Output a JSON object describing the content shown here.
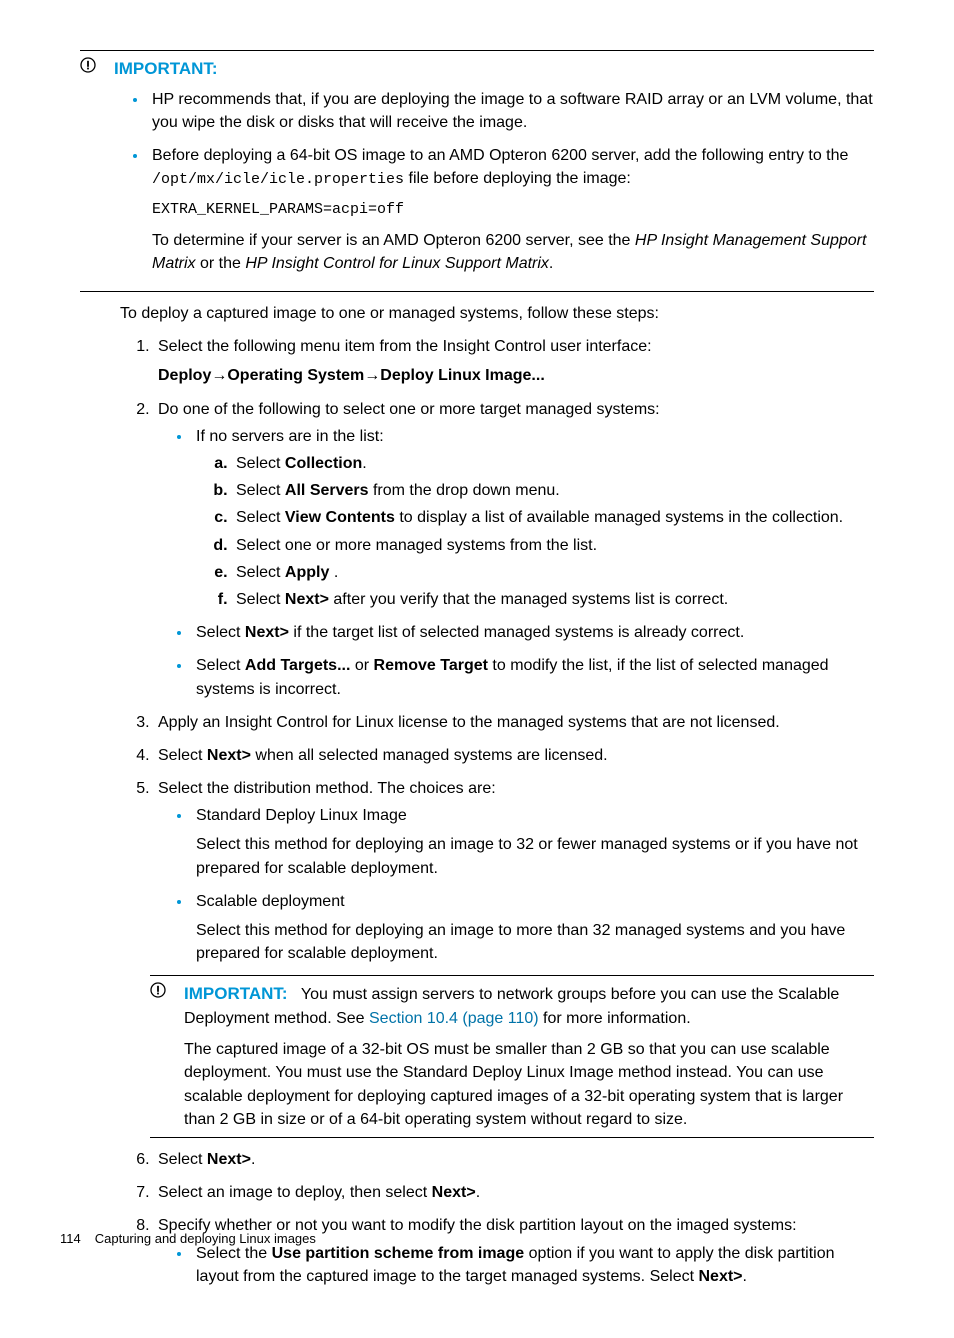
{
  "important1": {
    "label": "IMPORTANT:",
    "li1": "HP recommends that, if you are deploying the image to a software RAID array or an LVM volume, that you wipe the disk or disks that will receive the image.",
    "li2_a": "Before deploying a 64-bit OS image to an AMD Opteron 6200 server, add the following entry to the ",
    "li2_code": "/opt/mx/icle/icle.properties",
    "li2_b": " file before deploying the image:",
    "li2_block": "EXTRA_KERNEL_PARAMS=acpi=off",
    "li2_c": "To determine if your server is an AMD Opteron 6200 server, see the ",
    "li2_i1": "HP Insight Management Support Matrix",
    "li2_d": "  or the ",
    "li2_i2": "HP Insight Control for Linux Support Matrix",
    "li2_e": "."
  },
  "intro": "To deploy a captured image to one or managed systems, follow these steps:",
  "step1": {
    "text": "Select the following menu item from the Insight Control user interface:",
    "menu_a": "Deploy",
    "menu_b": "Operating System",
    "menu_c": "Deploy Linux Image..."
  },
  "step2": {
    "text": "Do one of the following to select one or more target managed systems:",
    "sub1": "If no servers are in the list:",
    "a_a": "Select ",
    "a_b": "Collection",
    "a_c": ".",
    "b_a": "Select ",
    "b_b": "All Servers",
    "b_c": " from the drop down menu.",
    "c_a": "Select ",
    "c_b": "View Contents",
    "c_c": " to display a list of available managed systems in the collection.",
    "d": "Select one or more managed systems from the list.",
    "e_a": "Select ",
    "e_b": "Apply",
    "e_c": " .",
    "f_a": "Select ",
    "f_b": "Next>",
    "f_c": " after you verify that the managed systems list is correct.",
    "sub2_a": "Select ",
    "sub2_b": "Next>",
    "sub2_c": " if the target list of selected managed systems is already correct.",
    "sub3_a": "Select ",
    "sub3_b": "Add Targets...",
    "sub3_c": " or ",
    "sub3_d": "Remove Target",
    "sub3_e": " to modify the list, if the list of selected managed systems is incorrect."
  },
  "step3": "Apply an Insight Control for Linux license to the managed systems that are not licensed.",
  "step4_a": "Select ",
  "step4_b": "Next>",
  "step4_c": " when all selected managed systems are licensed.",
  "step5": {
    "text": "Select the distribution method. The choices are:",
    "sub1_h": "Standard Deploy Linux Image",
    "sub1_p": "Select this method for deploying an image to 32 or fewer managed systems or if you have not prepared for scalable deployment.",
    "sub2_h": "Scalable deployment",
    "sub2_p": "Select this method for deploying an image to more than 32 managed systems and you have prepared for scalable deployment."
  },
  "important2": {
    "label": "IMPORTANT:",
    "p1_a": "You must assign servers to network groups before you can use the Scalable Deployment method. See ",
    "p1_link": "Section 10.4 (page 110)",
    "p1_b": " for more information.",
    "p2": "The captured image of a 32-bit OS must be smaller than 2 GB so that you can use scalable deployment. You must use the Standard Deploy Linux Image method instead. You can use scalable deployment for deploying captured images of a 32-bit operating system that is larger than 2 GB in size or of a 64-bit operating system without regard to size."
  },
  "step6_a": "Select ",
  "step6_b": "Next>",
  "step6_c": ".",
  "step7_a": "Select an image to deploy, then select ",
  "step7_b": "Next>",
  "step7_c": ".",
  "step8": {
    "text": "Specify whether or not you want to modify the disk partition layout on the imaged systems:",
    "sub1_a": "Select the ",
    "sub1_b": "Use partition scheme from image",
    "sub1_c": " option if you want to apply the disk partition layout from the captured image to the target managed systems. Select ",
    "sub1_d": "Next>",
    "sub1_e": "."
  },
  "footer": {
    "page": "114",
    "title": "Capturing and deploying Linux images"
  }
}
